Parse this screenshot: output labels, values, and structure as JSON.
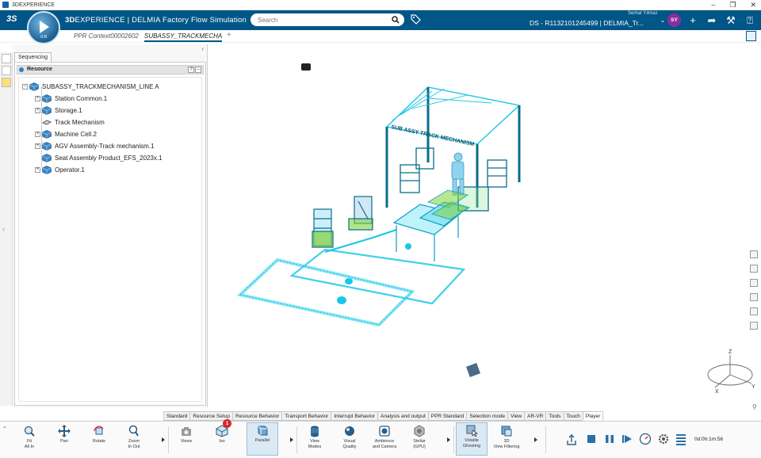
{
  "window": {
    "title": "3DEXPERIENCE"
  },
  "app": {
    "brand_prefix": "3D",
    "brand_main": "EXPERIENCE | DELMIA",
    "brand_suffix": "Factory Flow Simulation",
    "compass_label": "V.R",
    "user_name": "Serhat Yılmaz",
    "user_initials": "SY",
    "tenant": "DS - R1132101245499 | DELMIA_Tr...",
    "search_placeholder": "Search"
  },
  "tabs": [
    {
      "label": "PPR Context00002602",
      "active": false
    },
    {
      "label": "SUBASSY_TRACKMECHANISM_LINE A",
      "active": true
    }
  ],
  "panel": {
    "tab": "Sequencing",
    "section": "Resource",
    "tree": [
      {
        "label": "SUBASSY_TRACKMECHANISM_LINE A",
        "level": 0,
        "expander": "−",
        "icon": "cube"
      },
      {
        "label": "Station Common.1",
        "level": 1,
        "expander": "+",
        "icon": "cube"
      },
      {
        "label": "Storage.1",
        "level": 1,
        "expander": "+",
        "icon": "cube"
      },
      {
        "label": "Track Mechanism",
        "level": 1,
        "expander": "",
        "icon": "part"
      },
      {
        "label": "Machine Cell.2",
        "level": 1,
        "expander": "+",
        "icon": "cube"
      },
      {
        "label": "AGV Assembly-Track mechanism.1",
        "level": 1,
        "expander": "+",
        "icon": "cube"
      },
      {
        "label": "Seat Assembly Product_EFS_2023x.1",
        "level": 1,
        "expander": "",
        "icon": "cube"
      },
      {
        "label": "Operator.1",
        "level": 1,
        "expander": "+",
        "icon": "cube"
      }
    ]
  },
  "scene": {
    "banner": "SUB ASSY TRACK MECHANISM",
    "axes": {
      "x": "X",
      "y": "Y",
      "z": "Z"
    }
  },
  "action_tabs": [
    "Standard",
    "Resource Setup",
    "Resource Behavior",
    "Transport Behavior",
    "Interrupt Behavior",
    "Analysis and output",
    "PPR Standard",
    "Selection mode",
    "View",
    "AR-VR",
    "Tools",
    "Touch",
    "Player"
  ],
  "active_action_tab": "Player",
  "toolbar": {
    "fit_all": "Fit\nAll In",
    "pan": "Pan",
    "rotate": "Rotate",
    "zoom": "Zoom\nIn Out",
    "views": "Views",
    "iso": "Iso",
    "iso_badge": "1",
    "parallel": "Parallel",
    "view_modes": "View\nModes",
    "visual_quality": "Visual\nQuality",
    "ambience": "Ambience\nand Camera",
    "stellar": "Stellar\n(GPU)",
    "volatile_ghosting": "Volatile\nGhosting",
    "view_filtering": "3D\nView Filtering",
    "timecode": "0d:0h:1m:56"
  },
  "colors": {
    "brand_bar": "#005686",
    "model_cyan": "#19c6e6",
    "accent_green": "#7ed23a",
    "avatar": "#8b2d9e"
  }
}
